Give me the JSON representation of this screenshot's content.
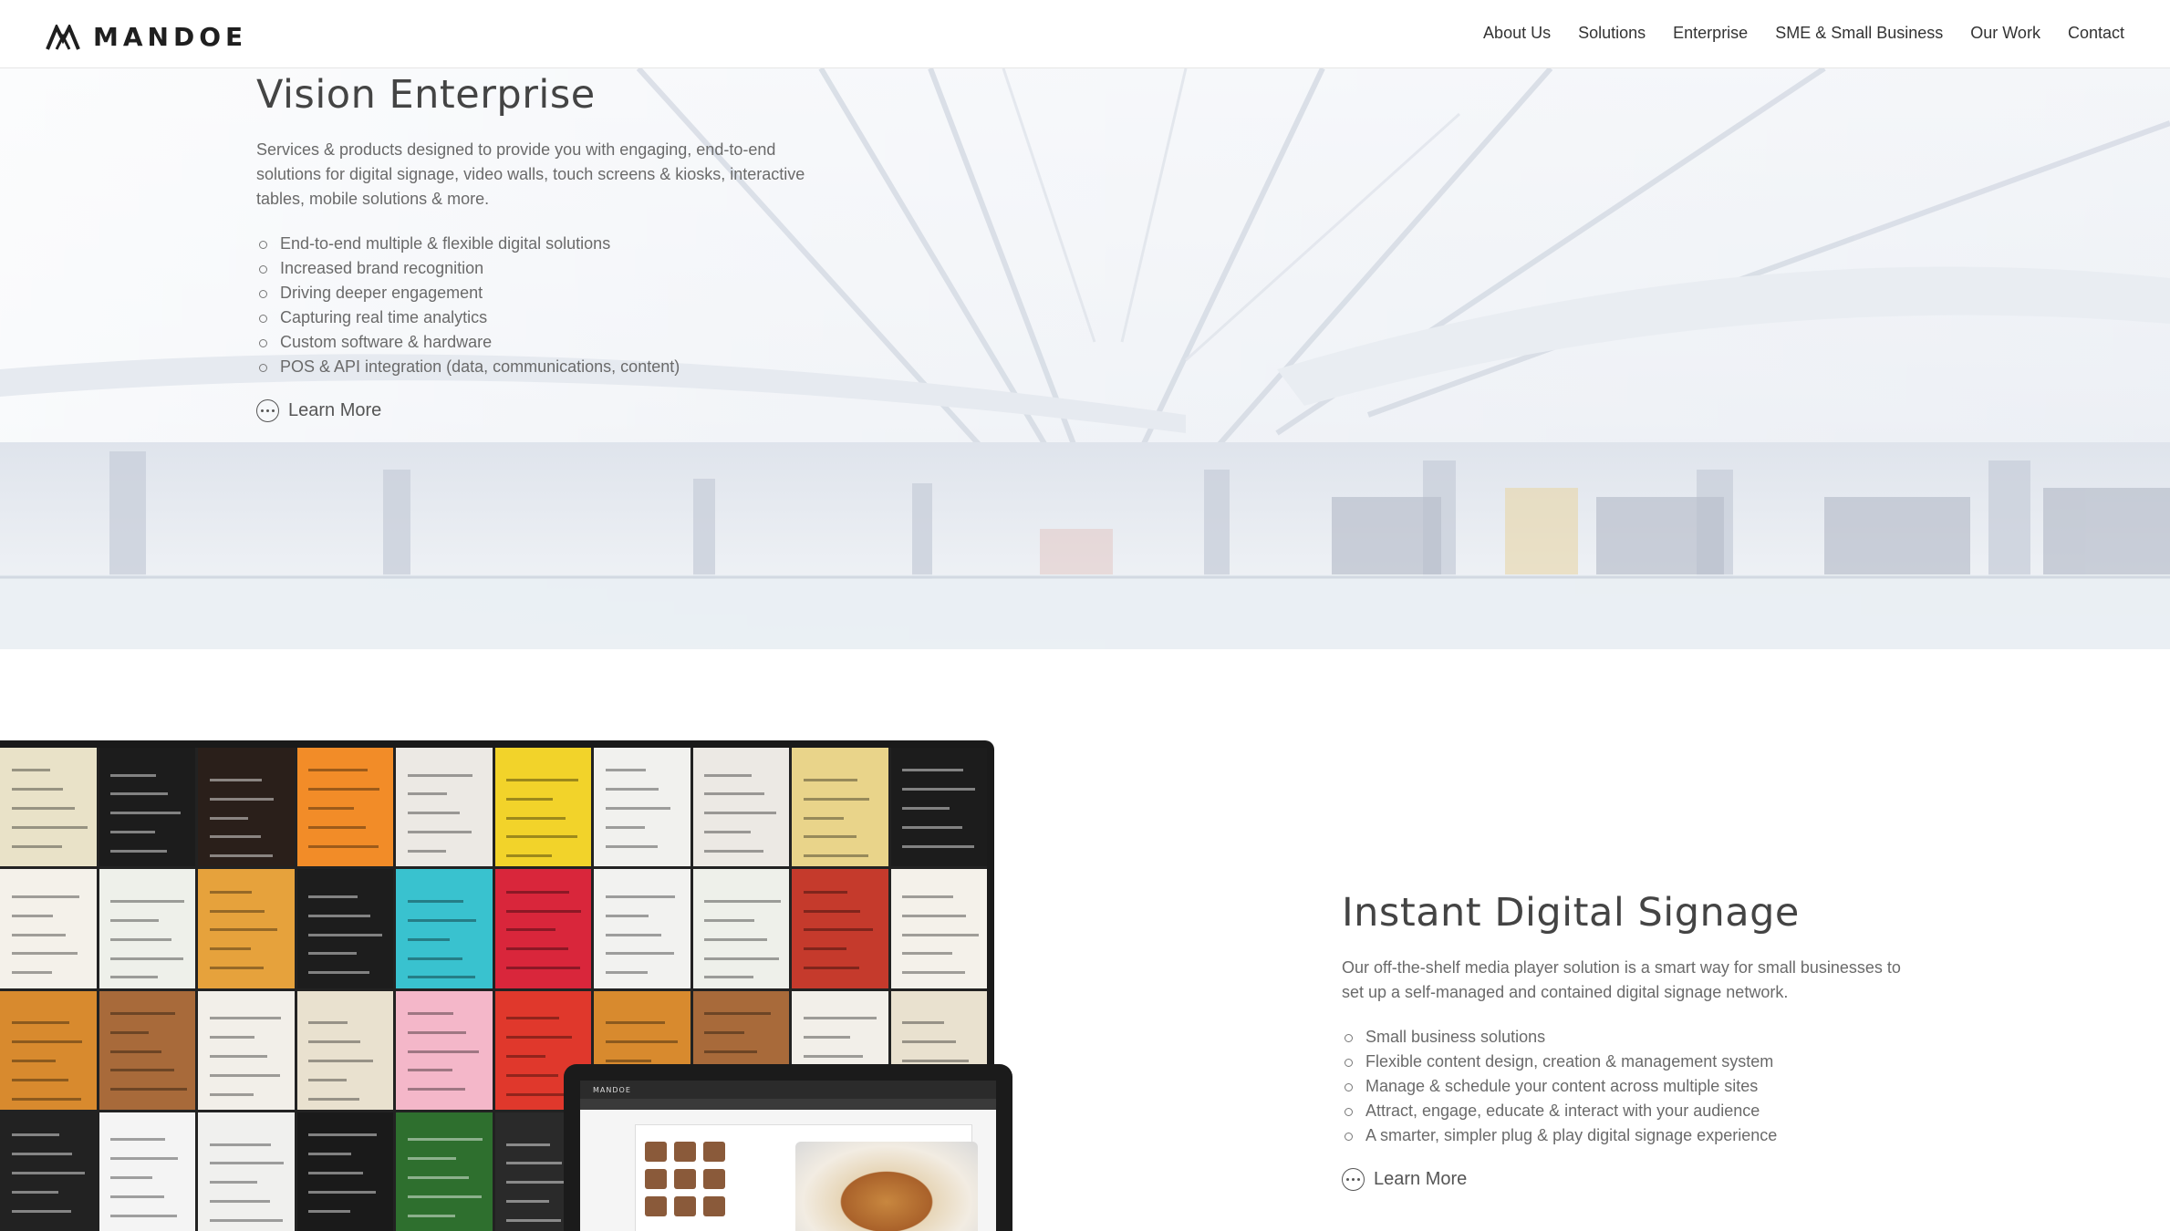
{
  "header": {
    "logo_text": "MANDOE",
    "nav": [
      "About Us",
      "Solutions",
      "Enterprise",
      "SME & Small Business",
      "Our Work",
      "Contact"
    ]
  },
  "hero": {
    "title": "Vision Enterprise",
    "description": "Services & products designed to provide you with engaging, end-to-end solutions for digital signage, video walls, touch screens & kiosks, interactive tables, mobile solutions & more.",
    "features": [
      "End-to-end multiple & flexible digital solutions",
      "Increased brand recognition",
      "Driving deeper engagement",
      "Capturing real time analytics",
      "Custom software & hardware",
      "POS & API integration (data, communications, content)"
    ],
    "learn_more": "Learn More"
  },
  "signage": {
    "title": "Instant Digital Signage",
    "description": "Our off-the-shelf media player solution is a smart way for small businesses to set up a self-managed and contained digital signage network.",
    "features": [
      "Small business solutions",
      "Flexible content design, creation & management system",
      "Manage & schedule your content across multiple sites",
      "Attract, engage, educate & interact with your audience",
      "A smarter, simpler plug & play digital signage experience"
    ],
    "learn_more": "Learn More",
    "laptop_brand": "MANDOE"
  },
  "menu_tile_colors": [
    "#e9e2c8",
    "#1c1c1c",
    "#2a1f1a",
    "#f28c28",
    "#ece9e4",
    "#f2d32a",
    "#f1f1ee",
    "#ece9e4",
    "#e9d48a",
    "#1c1c1c",
    "#f4f1ea",
    "#eef0ea",
    "#e6a23c",
    "#1d1d1d",
    "#39c2cf",
    "#d9263b",
    "#f2f2f0",
    "#eef0ea",
    "#c53a2c",
    "#f4f1ea",
    "#d88a2e",
    "#a86a3a",
    "#f2efe9",
    "#e9e1cf",
    "#f4b7c9",
    "#e0382c",
    "#d88a2e",
    "#a86a3a",
    "#f2efe9",
    "#e9e1cf",
    "#222222",
    "#f4f4f4",
    "#f0f0ee",
    "#1a1a1a",
    "#2e6f2e",
    "#2a2a2a",
    "#e13b33",
    "#e8e8e8",
    "#f4f4f4",
    "#e0382c"
  ]
}
